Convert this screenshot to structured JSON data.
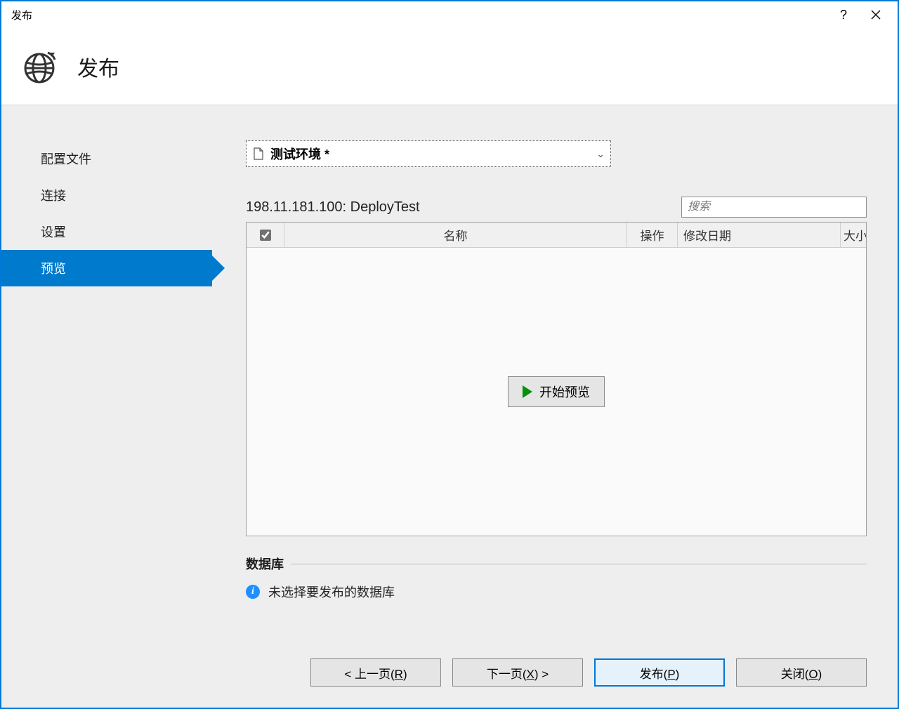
{
  "window": {
    "title": "发布"
  },
  "header": {
    "page_title": "发布"
  },
  "sidebar": {
    "items": [
      {
        "label": "配置文件"
      },
      {
        "label": "连接"
      },
      {
        "label": "设置"
      },
      {
        "label": "预览"
      }
    ]
  },
  "profile": {
    "selected": "测试环境 *"
  },
  "server": {
    "label": "198.11.181.100: DeployTest"
  },
  "search": {
    "placeholder": "搜索"
  },
  "grid": {
    "columns": {
      "name": "名称",
      "op": "操作",
      "date": "修改日期",
      "size": "大小"
    },
    "start_preview": "开始预览"
  },
  "database": {
    "heading": "数据库",
    "info_text": "未选择要发布的数据库"
  },
  "footer": {
    "prev_prefix": "< 上一页(",
    "prev_key": "R",
    "prev_suffix": ")",
    "next_prefix": "下一页(",
    "next_key": "X",
    "next_suffix": ") >",
    "publish_prefix": "发布(",
    "publish_key": "P",
    "publish_suffix": ")",
    "close_prefix": "关闭(",
    "close_key": "O",
    "close_suffix": ")"
  }
}
